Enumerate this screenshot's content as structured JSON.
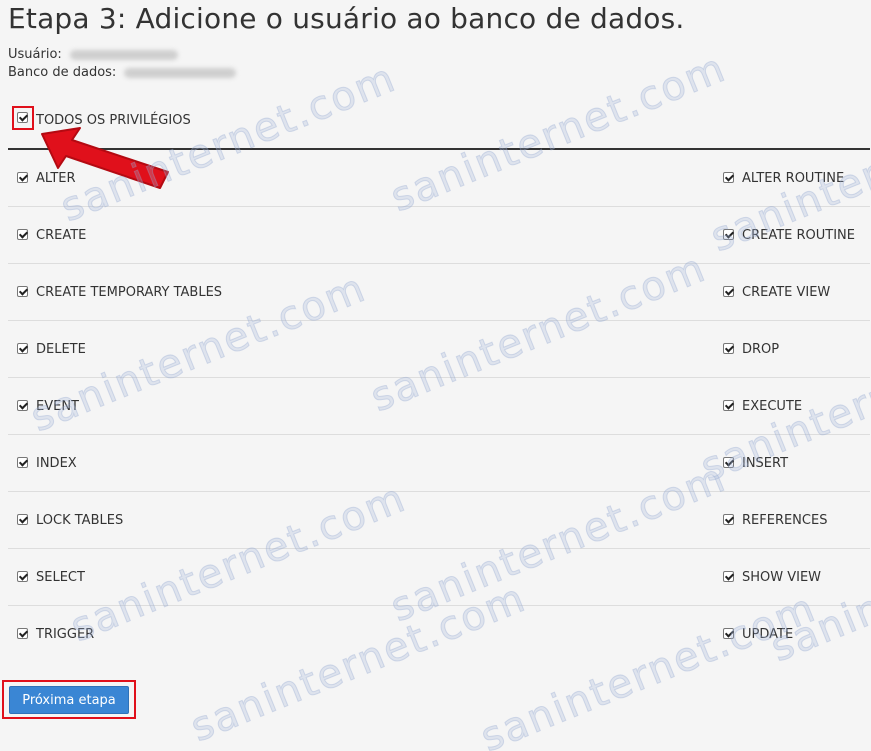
{
  "page": {
    "title": "Etapa 3: Adicione o usuário ao banco de dados.",
    "user_label": "Usuário:",
    "db_label": "Banco de dados:"
  },
  "all_privileges": {
    "label": "TODOS OS PRIVILÉGIOS",
    "checked": true
  },
  "privileges": {
    "left": [
      "ALTER",
      "CREATE",
      "CREATE TEMPORARY TABLES",
      "DELETE",
      "EVENT",
      "INDEX",
      "LOCK TABLES",
      "SELECT",
      "TRIGGER"
    ],
    "right": [
      "ALTER ROUTINE",
      "CREATE ROUTINE",
      "CREATE VIEW",
      "DROP",
      "EXECUTE",
      "INSERT",
      "REFERENCES",
      "SHOW VIEW",
      "UPDATE"
    ]
  },
  "next_button": {
    "label": "Próxima etapa"
  },
  "watermark": {
    "text": "saninternet.com"
  },
  "colors": {
    "highlight": "#e0101b",
    "button": "#3a86d4"
  }
}
